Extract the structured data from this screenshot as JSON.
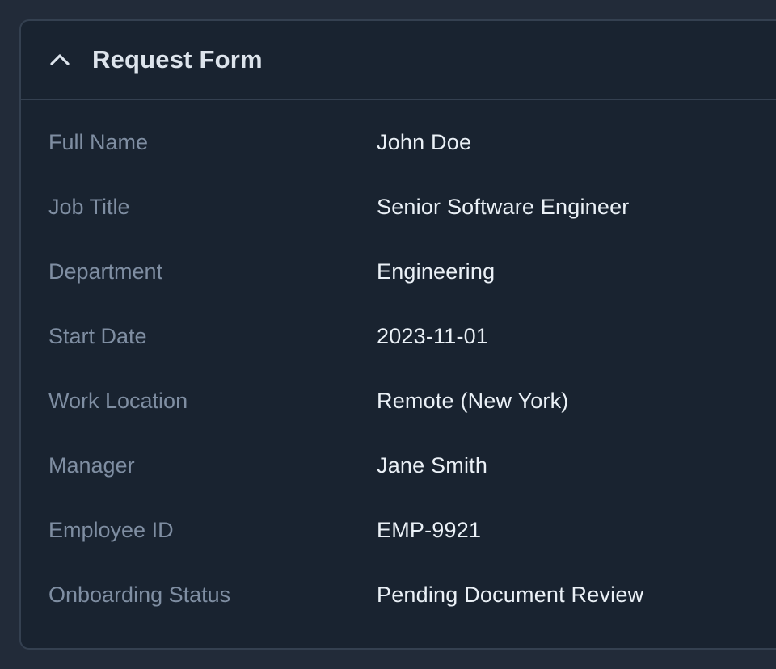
{
  "form": {
    "title": "Request Form",
    "toggle_icon": "chevron-up-icon",
    "fields": [
      {
        "label": "Full Name",
        "value": "John Doe"
      },
      {
        "label": "Job Title",
        "value": "Senior Software Engineer"
      },
      {
        "label": "Department",
        "value": "Engineering"
      },
      {
        "label": "Start Date",
        "value": "2023-11-01"
      },
      {
        "label": "Work Location",
        "value": "Remote (New York)"
      },
      {
        "label": "Manager",
        "value": "Jane Smith"
      },
      {
        "label": "Employee ID",
        "value": "EMP-9921"
      },
      {
        "label": "Onboarding Status",
        "value": "Pending Document Review"
      }
    ]
  },
  "colors": {
    "page_background": "#222b39",
    "panel_background": "#192330",
    "border": "#344050",
    "label_text": "#7f8ea2",
    "value_text": "#eaf0f6",
    "title_text": "#dde4ec"
  }
}
